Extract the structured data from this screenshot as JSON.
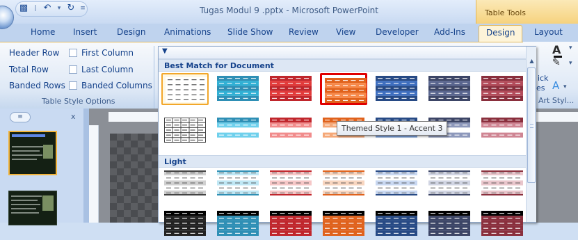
{
  "window": {
    "title": "Tugas Modul 9 .pptx - Microsoft PowerPoint",
    "context_title": "Table Tools"
  },
  "tabs": [
    {
      "label": "Home"
    },
    {
      "label": "Insert"
    },
    {
      "label": "Design"
    },
    {
      "label": "Animations"
    },
    {
      "label": "Slide Show"
    },
    {
      "label": "Review"
    },
    {
      "label": "View"
    },
    {
      "label": "Developer"
    },
    {
      "label": "Add-Ins"
    },
    {
      "label": "Design"
    },
    {
      "label": "Layout"
    }
  ],
  "ribbon": {
    "options": {
      "header_row": "Header Row",
      "total_row": "Total Row",
      "banded_rows": "Banded Rows",
      "first_column": "First Column",
      "last_column": "Last Column",
      "banded_columns": "Banded Columns",
      "group_label": "Table Style Options"
    },
    "right_fragments": {
      "quick_styles": "ick",
      "styles_label": "es",
      "art_label": "Art Styl..."
    }
  },
  "gallery": {
    "section_best_match": "Best Match for Document",
    "section_light": "Light",
    "tooltip": "Themed Style 1 - Accent 3",
    "row1": [
      {
        "kind": "plain",
        "color": "#444444",
        "band": "#ffffff"
      },
      {
        "kind": "themed",
        "color": "#2e8fb5",
        "band": "#31b0d4"
      },
      {
        "kind": "themed",
        "color": "#c0262c",
        "band": "#e23b3b"
      },
      {
        "kind": "themed",
        "color": "#e0621c",
        "band": "#f7894a"
      },
      {
        "kind": "themed",
        "color": "#274a85",
        "band": "#3f6fbf"
      },
      {
        "kind": "themed",
        "color": "#3c4566",
        "band": "#5a668f"
      },
      {
        "kind": "themed",
        "color": "#8a2f3d",
        "band": "#b34b5a"
      }
    ],
    "row2": [
      {
        "kind": "grid",
        "color": "#444444",
        "band": "#ffffff"
      },
      {
        "kind": "medium",
        "color": "#2e8fb5",
        "band": "#6fd0ec"
      },
      {
        "kind": "medium",
        "color": "#c0262c",
        "band": "#f18c8c"
      },
      {
        "kind": "medium",
        "color": "#e0621c",
        "band": "#f5a878"
      },
      {
        "kind": "medium",
        "color": "#274a85",
        "band": "#7da1dc"
      },
      {
        "kind": "medium",
        "color": "#3c4566",
        "band": "#8d98bb"
      },
      {
        "kind": "medium",
        "color": "#8a2f3d",
        "band": "#cf8593"
      }
    ],
    "row3": [
      {
        "kind": "light",
        "color": "#444444",
        "band": "#d0d0d0"
      },
      {
        "kind": "light",
        "color": "#2e8fb5",
        "band": "#bfe7f4"
      },
      {
        "kind": "light",
        "color": "#c0262c",
        "band": "#f6c7c7"
      },
      {
        "kind": "light",
        "color": "#e0621c",
        "band": "#f8d6c0"
      },
      {
        "kind": "light",
        "color": "#274a85",
        "band": "#c9d8f1"
      },
      {
        "kind": "light",
        "color": "#3c4566",
        "band": "#d1d5e3"
      },
      {
        "kind": "light",
        "color": "#8a2f3d",
        "band": "#e9c6cc"
      }
    ],
    "row4": [
      {
        "kind": "dark",
        "color": "#222222"
      },
      {
        "kind": "dark",
        "color": "#2e8fb5"
      },
      {
        "kind": "dark",
        "color": "#c0262c"
      },
      {
        "kind": "dark",
        "color": "#e0621c"
      },
      {
        "kind": "dark",
        "color": "#274a85"
      },
      {
        "kind": "dark",
        "color": "#3c4566"
      },
      {
        "kind": "dark",
        "color": "#8a2f3d"
      }
    ]
  }
}
